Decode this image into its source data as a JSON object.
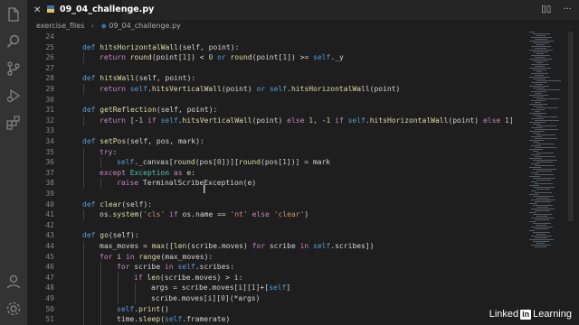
{
  "tab": {
    "label": "09_04_challenge.py"
  },
  "tab_actions": {
    "split": "▯▯",
    "more": "···"
  },
  "breadcrumb": {
    "folder": "exercise_files",
    "file": "09_04_challenge.py"
  },
  "watermark": {
    "brand_left": "Linked",
    "brand_box": "in",
    "brand_right": " Learning"
  },
  "colors": {
    "keyword": "#569cd6",
    "function": "#dcdcaa",
    "number": "#b5cea8",
    "string": "#ce9178",
    "class": "#4ec9b0",
    "control": "#c586c0"
  },
  "icons": [
    "files-icon",
    "search-icon",
    "source-control-icon",
    "run-debug-icon",
    "extensions-icon",
    "account-icon",
    "settings-icon"
  ],
  "code_lines": [
    {
      "n": "24",
      "indent": 0,
      "tokens": []
    },
    {
      "n": "25",
      "indent": 1,
      "tokens": [
        [
          "kw",
          "def "
        ],
        [
          "fn",
          "hitsHorizontalWall"
        ],
        [
          "txt",
          "(self, point):"
        ]
      ]
    },
    {
      "n": "26",
      "indent": 2,
      "tokens": [
        [
          "ctl",
          "return "
        ],
        [
          "fn",
          "round"
        ],
        [
          "txt",
          "(point["
        ],
        [
          "num",
          "1"
        ],
        [
          "txt",
          "]) < "
        ],
        [
          "num",
          "0"
        ],
        [
          "kw",
          " or "
        ],
        [
          "fn",
          "round"
        ],
        [
          "txt",
          "(point["
        ],
        [
          "num",
          "1"
        ],
        [
          "txt",
          "]) >= "
        ],
        [
          "self",
          "self"
        ],
        [
          "txt",
          "._y"
        ]
      ]
    },
    {
      "n": "27",
      "indent": 0,
      "tokens": []
    },
    {
      "n": "28",
      "indent": 1,
      "tokens": [
        [
          "kw",
          "def "
        ],
        [
          "fn",
          "hitsWall"
        ],
        [
          "txt",
          "(self, point):"
        ]
      ]
    },
    {
      "n": "29",
      "indent": 2,
      "tokens": [
        [
          "ctl",
          "return "
        ],
        [
          "self",
          "self"
        ],
        [
          "txt",
          "."
        ],
        [
          "fn",
          "hitsVerticalWall"
        ],
        [
          "txt",
          "(point) "
        ],
        [
          "kw",
          "or "
        ],
        [
          "self",
          "self"
        ],
        [
          "txt",
          "."
        ],
        [
          "fn",
          "hitsHorizontalWall"
        ],
        [
          "txt",
          "(point)"
        ]
      ]
    },
    {
      "n": "30",
      "indent": 0,
      "tokens": []
    },
    {
      "n": "31",
      "indent": 1,
      "tokens": [
        [
          "kw",
          "def "
        ],
        [
          "fn",
          "getReflection"
        ],
        [
          "txt",
          "(self, point):"
        ]
      ]
    },
    {
      "n": "32",
      "indent": 2,
      "tokens": [
        [
          "ctl",
          "return "
        ],
        [
          "txt",
          "[-"
        ],
        [
          "num",
          "1"
        ],
        [
          "ctl",
          " if "
        ],
        [
          "self",
          "self"
        ],
        [
          "txt",
          "."
        ],
        [
          "fn",
          "hitsVerticalWall"
        ],
        [
          "txt",
          "(point) "
        ],
        [
          "ctl",
          "else "
        ],
        [
          "num",
          "1"
        ],
        [
          "txt",
          ", -"
        ],
        [
          "num",
          "1"
        ],
        [
          "ctl",
          " if "
        ],
        [
          "self",
          "self"
        ],
        [
          "txt",
          "."
        ],
        [
          "fn",
          "hitsHorizontalWall"
        ],
        [
          "txt",
          "(point) "
        ],
        [
          "ctl",
          "else "
        ],
        [
          "num",
          "1"
        ],
        [
          "txt",
          "]"
        ]
      ]
    },
    {
      "n": "33",
      "indent": 0,
      "tokens": []
    },
    {
      "n": "34",
      "indent": 1,
      "tokens": [
        [
          "kw",
          "def "
        ],
        [
          "fn",
          "setPos"
        ],
        [
          "txt",
          "(self, pos, mark):"
        ]
      ]
    },
    {
      "n": "35",
      "indent": 2,
      "tokens": [
        [
          "ctl",
          "try"
        ],
        [
          "txt",
          ":"
        ]
      ]
    },
    {
      "n": "36",
      "indent": 3,
      "tokens": [
        [
          "self",
          "self"
        ],
        [
          "txt",
          "._canvas["
        ],
        [
          "fn",
          "round"
        ],
        [
          "txt",
          "(pos["
        ],
        [
          "num",
          "0"
        ],
        [
          "txt",
          "])]["
        ],
        [
          "fn",
          "round"
        ],
        [
          "txt",
          "(pos["
        ],
        [
          "num",
          "1"
        ],
        [
          "txt",
          "])] = mark"
        ]
      ]
    },
    {
      "n": "37",
      "indent": 2,
      "tokens": [
        [
          "ctl",
          "except "
        ],
        [
          "cls",
          "Exception"
        ],
        [
          "ctl",
          " as "
        ],
        [
          "txt",
          "e:"
        ]
      ]
    },
    {
      "n": "38",
      "indent": 3,
      "tokens": [
        [
          "ctl",
          "raise "
        ],
        [
          "txt",
          "TerminalScribeException(e)"
        ]
      ]
    },
    {
      "n": "39",
      "indent": 0,
      "tokens": []
    },
    {
      "n": "40",
      "indent": 1,
      "tokens": [
        [
          "kw",
          "def "
        ],
        [
          "fn",
          "clear"
        ],
        [
          "txt",
          "(self):"
        ]
      ]
    },
    {
      "n": "41",
      "indent": 2,
      "tokens": [
        [
          "txt",
          "os."
        ],
        [
          "fn",
          "system"
        ],
        [
          "txt",
          "("
        ],
        [
          "str",
          "'cls'"
        ],
        [
          "ctl",
          " if "
        ],
        [
          "txt",
          "os.name == "
        ],
        [
          "str",
          "'nt'"
        ],
        [
          "ctl",
          " else "
        ],
        [
          "str",
          "'clear'"
        ],
        [
          "txt",
          ")"
        ]
      ]
    },
    {
      "n": "42",
      "indent": 0,
      "tokens": []
    },
    {
      "n": "43",
      "indent": 1,
      "tokens": [
        [
          "kw",
          "def "
        ],
        [
          "fn",
          "go"
        ],
        [
          "txt",
          "(self):"
        ]
      ]
    },
    {
      "n": "44",
      "indent": 2,
      "tokens": [
        [
          "txt",
          "max_moves = "
        ],
        [
          "fn",
          "max"
        ],
        [
          "txt",
          "(["
        ],
        [
          "fn",
          "len"
        ],
        [
          "txt",
          "(scribe.moves) "
        ],
        [
          "ctl",
          "for "
        ],
        [
          "txt",
          "scribe "
        ],
        [
          "ctl",
          "in "
        ],
        [
          "self",
          "self"
        ],
        [
          "txt",
          ".scribes])"
        ]
      ]
    },
    {
      "n": "45",
      "indent": 2,
      "tokens": [
        [
          "ctl",
          "for "
        ],
        [
          "txt",
          "i "
        ],
        [
          "ctl",
          "in "
        ],
        [
          "fn",
          "range"
        ],
        [
          "txt",
          "(max_moves):"
        ]
      ]
    },
    {
      "n": "46",
      "indent": 3,
      "tokens": [
        [
          "ctl",
          "for "
        ],
        [
          "txt",
          "scribe "
        ],
        [
          "ctl",
          "in "
        ],
        [
          "self",
          "self"
        ],
        [
          "txt",
          ".scribes:"
        ]
      ]
    },
    {
      "n": "47",
      "indent": 4,
      "tokens": [
        [
          "ctl",
          "if "
        ],
        [
          "fn",
          "len"
        ],
        [
          "txt",
          "(scribe.moves) > i:"
        ]
      ]
    },
    {
      "n": "48",
      "indent": 5,
      "tokens": [
        [
          "txt",
          "args = scribe.moves[i]["
        ],
        [
          "num",
          "1"
        ],
        [
          "txt",
          "]+["
        ],
        [
          "self",
          "self"
        ],
        [
          "txt",
          "]"
        ]
      ]
    },
    {
      "n": "49",
      "indent": 5,
      "tokens": [
        [
          "txt",
          "scribe.moves[i]["
        ],
        [
          "num",
          "0"
        ],
        [
          "txt",
          "](*args)"
        ]
      ]
    },
    {
      "n": "50",
      "indent": 3,
      "tokens": [
        [
          "self",
          "self"
        ],
        [
          "txt",
          "."
        ],
        [
          "fn",
          "print"
        ],
        [
          "txt",
          "()"
        ]
      ]
    },
    {
      "n": "51",
      "indent": 3,
      "tokens": [
        [
          "txt",
          "time."
        ],
        [
          "fn",
          "sleep"
        ],
        [
          "txt",
          "("
        ],
        [
          "self",
          "self"
        ],
        [
          "txt",
          ".framerate)"
        ]
      ]
    }
  ]
}
